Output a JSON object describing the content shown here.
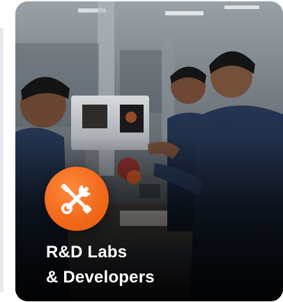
{
  "card": {
    "title_line1": "R&D Labs",
    "title_line2": "& Developers",
    "icon": "wrench-screwdriver-icon",
    "accent_color": "#f36a1c",
    "photo_subject": "lab-engineers-photo"
  }
}
